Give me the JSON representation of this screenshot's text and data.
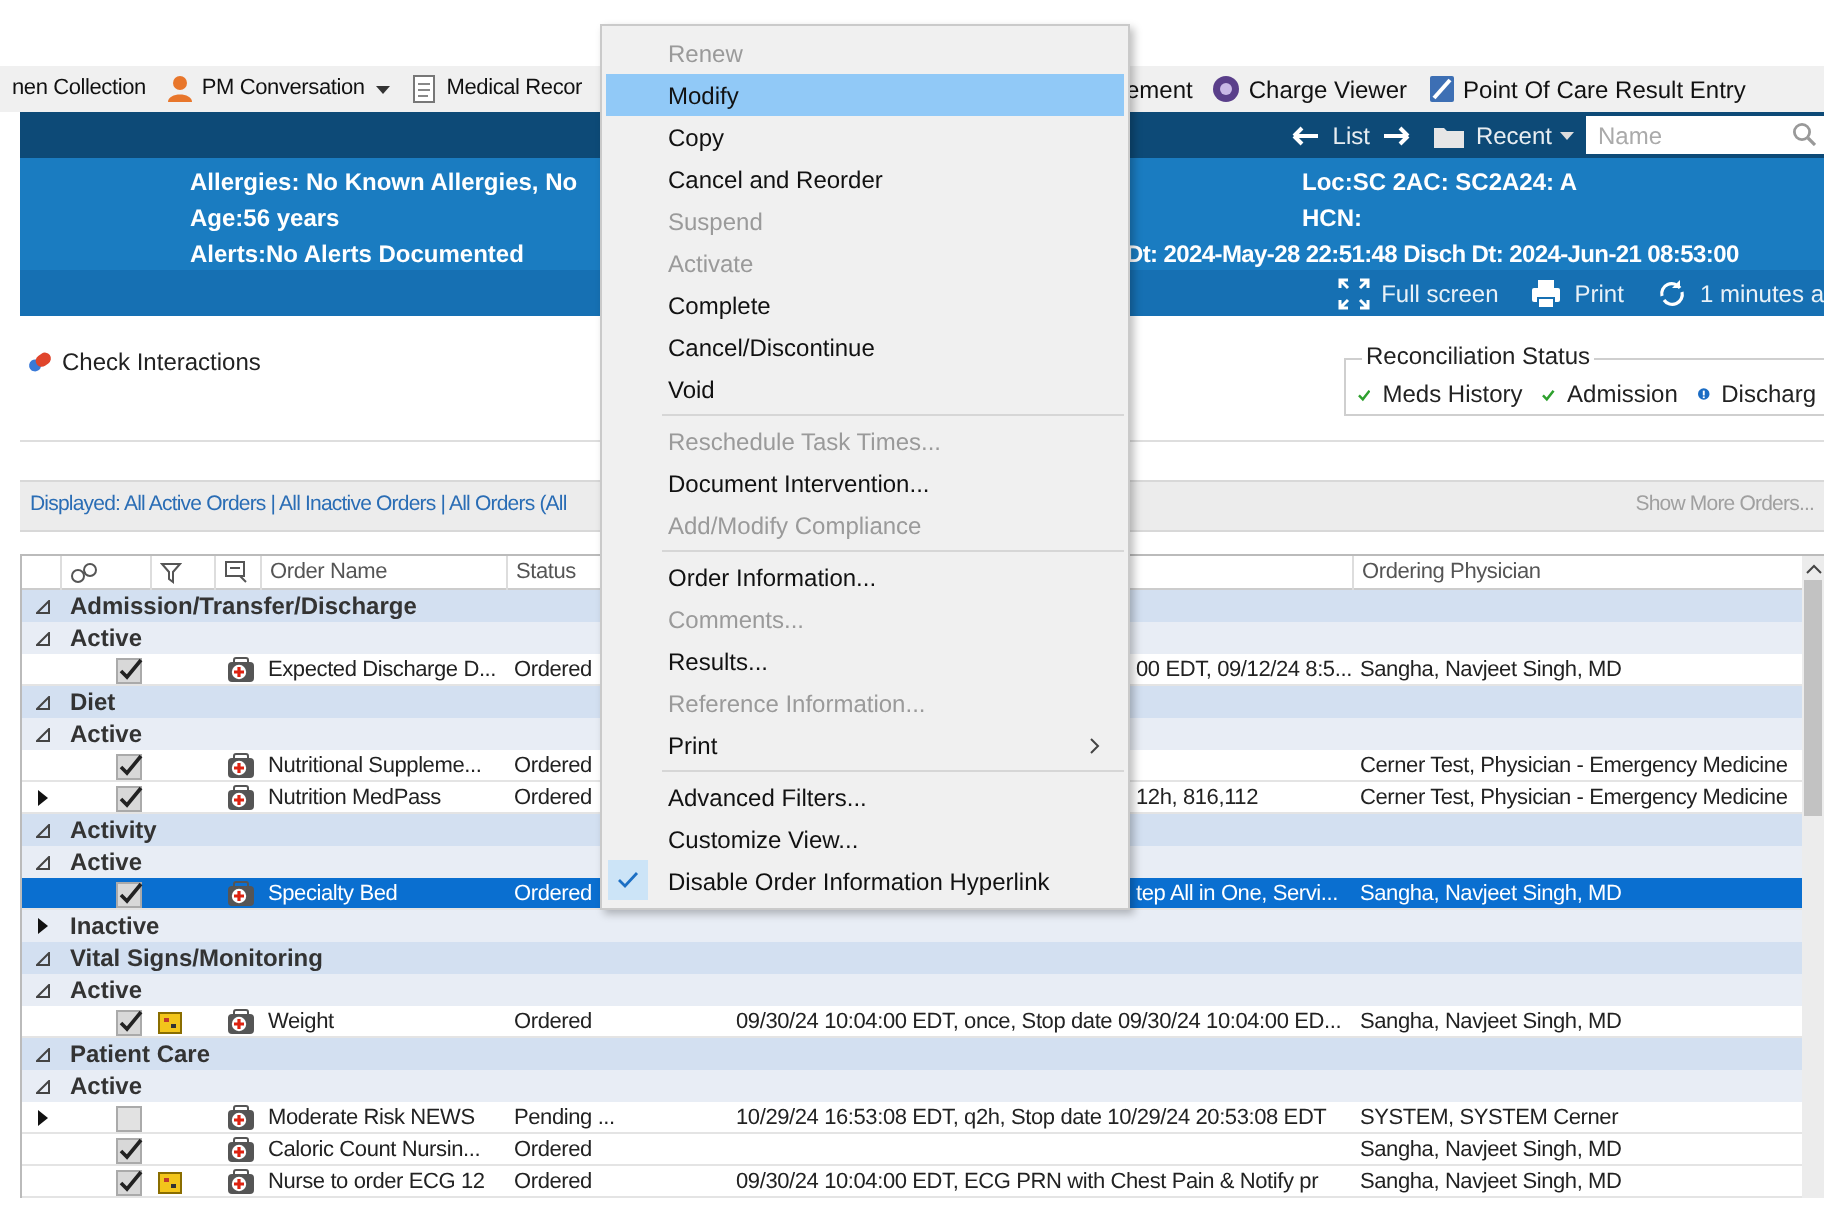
{
  "toolbar": {
    "left": [
      {
        "label": "nen Collection",
        "kind": "text",
        "dropdown": false
      },
      {
        "label": "PM Conversation",
        "kind": "person",
        "dropdown": true
      },
      {
        "label": "Medical Recor",
        "kind": "document",
        "dropdown": false
      }
    ],
    "right": [
      {
        "label": "ement",
        "kind": "text",
        "dropdown": false
      },
      {
        "label": "Charge Viewer",
        "kind": "coin",
        "dropdown": false
      },
      {
        "label": "Point Of Care Result Entry",
        "kind": "tablet",
        "dropdown": false
      }
    ]
  },
  "nav": {
    "list_label": "List",
    "recent_label": "Recent",
    "search_placeholder": "Name"
  },
  "banner": {
    "left_lines": [
      "Allergies: No Known Allergies, No",
      "Age:56 years",
      "Alerts:No Alerts Documented"
    ],
    "right_lines": [
      "Loc:SC 2AC: SC2A24: A",
      "HCN:"
    ],
    "dates_line": "Dt: 2024-May-28 22:51:48 Disch Dt: 2024-Jun-21 08:53:00"
  },
  "actions": [
    {
      "label": "Full screen",
      "kind": "fullscreen"
    },
    {
      "label": "Print",
      "kind": "print"
    },
    {
      "label": "1 minutes a",
      "kind": "refresh"
    }
  ],
  "check_interactions": "Check Interactions",
  "reconciliation": {
    "title": "Reconciliation Status",
    "items": [
      {
        "label": "Meds History",
        "complete": true
      },
      {
        "label": "Admission",
        "complete": true
      },
      {
        "label": "Discharg",
        "complete": false
      }
    ]
  },
  "filter_bar": {
    "displayed": "Displayed: All Active Orders | All Inactive Orders | All Orders (All",
    "show_more": "Show More Orders..."
  },
  "table": {
    "columns": {
      "order_name": "Order Name",
      "status": "Status",
      "ordering_physician": "Ordering Physician"
    },
    "rows": [
      {
        "kind": "category",
        "label": "Admission/Transfer/Discharge",
        "expanded": true,
        "selected": false
      },
      {
        "kind": "subgroup",
        "label": "Active",
        "expanded": true,
        "selected": false
      },
      {
        "kind": "order",
        "name": "Expected Discharge D...",
        "status": "Ordered",
        "details": "00 EDT, 09/12/24 8:5...",
        "physician": "Sangha, Navjeet Singh, MD",
        "checked": true,
        "reminder": false,
        "expandable": false,
        "selected": false
      },
      {
        "kind": "category",
        "label": "Diet",
        "expanded": true,
        "selected": false
      },
      {
        "kind": "subgroup",
        "label": "Active",
        "expanded": true,
        "selected": false
      },
      {
        "kind": "order",
        "name": "Nutritional Suppleme...",
        "status": "Ordered",
        "physician": "Cerner Test, Physician - Emergency Medicine",
        "checked": true,
        "reminder": false,
        "expandable": false,
        "selected": false
      },
      {
        "kind": "order",
        "name": "Nutrition MedPass",
        "status": "Ordered",
        "details": "12h, 816,112",
        "physician": "Cerner Test, Physician - Emergency Medicine",
        "checked": true,
        "reminder": false,
        "expandable": true,
        "selected": false
      },
      {
        "kind": "category",
        "label": "Activity",
        "expanded": true,
        "selected": false
      },
      {
        "kind": "subgroup",
        "label": "Active",
        "expanded": true,
        "selected": false
      },
      {
        "kind": "order",
        "name": "Specialty Bed",
        "status": "Ordered",
        "details": "tep All in One, Servi...",
        "physician": "Sangha, Navjeet Singh, MD",
        "checked": true,
        "reminder": false,
        "expandable": false,
        "selected": true
      },
      {
        "kind": "subgroup",
        "label": "Inactive",
        "expanded": false,
        "selected": false
      },
      {
        "kind": "category",
        "label": "Vital Signs/Monitoring",
        "expanded": true,
        "selected": false
      },
      {
        "kind": "subgroup",
        "label": "Active",
        "expanded": true,
        "selected": false
      },
      {
        "kind": "order",
        "name": "Weight",
        "status": "Ordered",
        "details": "09/30/24 10:04:00 EDT, once, Stop date 09/30/24 10:04:00 ED...",
        "physician": "Sangha, Navjeet Singh, MD",
        "checked": true,
        "reminder": true,
        "expandable": false,
        "selected": false
      },
      {
        "kind": "category",
        "label": "Patient Care",
        "expanded": true,
        "selected": false
      },
      {
        "kind": "subgroup",
        "label": "Active",
        "expanded": true,
        "selected": false
      },
      {
        "kind": "order",
        "name": "Moderate Risk NEWS",
        "status": "Pending ...",
        "details": "10/29/24 16:53:08 EDT, q2h, Stop date 10/29/24 20:53:08 EDT",
        "physician": "SYSTEM, SYSTEM Cerner",
        "checked": false,
        "reminder": false,
        "expandable": true,
        "selected": false
      },
      {
        "kind": "order",
        "name": "Caloric Count Nursin...",
        "status": "Ordered",
        "physician": "Sangha, Navjeet Singh, MD",
        "checked": true,
        "reminder": false,
        "expandable": false,
        "selected": false
      },
      {
        "kind": "order",
        "name": "Nurse to order ECG 12",
        "status": "Ordered",
        "details": "09/30/24 10:04:00 EDT, ECG PRN with Chest Pain & Notify pr",
        "physician": "Sangha, Navjeet Singh, MD",
        "checked": true,
        "reminder": true,
        "expandable": false,
        "selected": false
      }
    ]
  },
  "context_menu": {
    "groups": [
      {
        "items": [
          {
            "label": "Renew",
            "kind": "command",
            "disabled": true,
            "selected": false,
            "checked": false
          },
          {
            "label": "Modify",
            "kind": "command",
            "disabled": false,
            "selected": true,
            "checked": false
          },
          {
            "label": "Copy",
            "kind": "command",
            "disabled": false,
            "selected": false,
            "checked": false
          },
          {
            "label": "Cancel and Reorder",
            "kind": "command",
            "disabled": false,
            "selected": false,
            "checked": false
          },
          {
            "label": "Suspend",
            "kind": "command",
            "disabled": true,
            "selected": false,
            "checked": false
          },
          {
            "label": "Activate",
            "kind": "command",
            "disabled": true,
            "selected": false,
            "checked": false
          },
          {
            "label": "Complete",
            "kind": "command",
            "disabled": false,
            "selected": false,
            "checked": false
          },
          {
            "label": "Cancel/Discontinue",
            "kind": "command",
            "disabled": false,
            "selected": false,
            "checked": false
          },
          {
            "label": "Void",
            "kind": "command",
            "disabled": false,
            "selected": false,
            "checked": false
          }
        ]
      },
      {
        "items": [
          {
            "label": "Reschedule Task Times...",
            "kind": "command",
            "disabled": true,
            "selected": false,
            "checked": false
          },
          {
            "label": "Document Intervention...",
            "kind": "command",
            "disabled": false,
            "selected": false,
            "checked": false
          },
          {
            "label": "Add/Modify Compliance",
            "kind": "command",
            "disabled": true,
            "selected": false,
            "checked": false
          }
        ]
      },
      {
        "items": [
          {
            "label": "Order Information...",
            "kind": "command",
            "disabled": false,
            "selected": false,
            "checked": false
          },
          {
            "label": "Comments...",
            "kind": "command",
            "disabled": true,
            "selected": false,
            "checked": false
          },
          {
            "label": "Results...",
            "kind": "command",
            "disabled": false,
            "selected": false,
            "checked": false
          },
          {
            "label": "Reference Information...",
            "kind": "command",
            "disabled": true,
            "selected": false,
            "checked": false
          },
          {
            "label": "Print",
            "kind": "submenu",
            "disabled": false,
            "selected": false,
            "checked": false
          }
        ]
      },
      {
        "items": [
          {
            "label": "Advanced Filters...",
            "kind": "command",
            "disabled": false,
            "selected": false,
            "checked": false
          },
          {
            "label": "Customize View...",
            "kind": "command",
            "disabled": false,
            "selected": false,
            "checked": false
          },
          {
            "label": "Disable Order Information Hyperlink",
            "kind": "command",
            "disabled": false,
            "selected": false,
            "checked": true
          }
        ]
      }
    ]
  }
}
